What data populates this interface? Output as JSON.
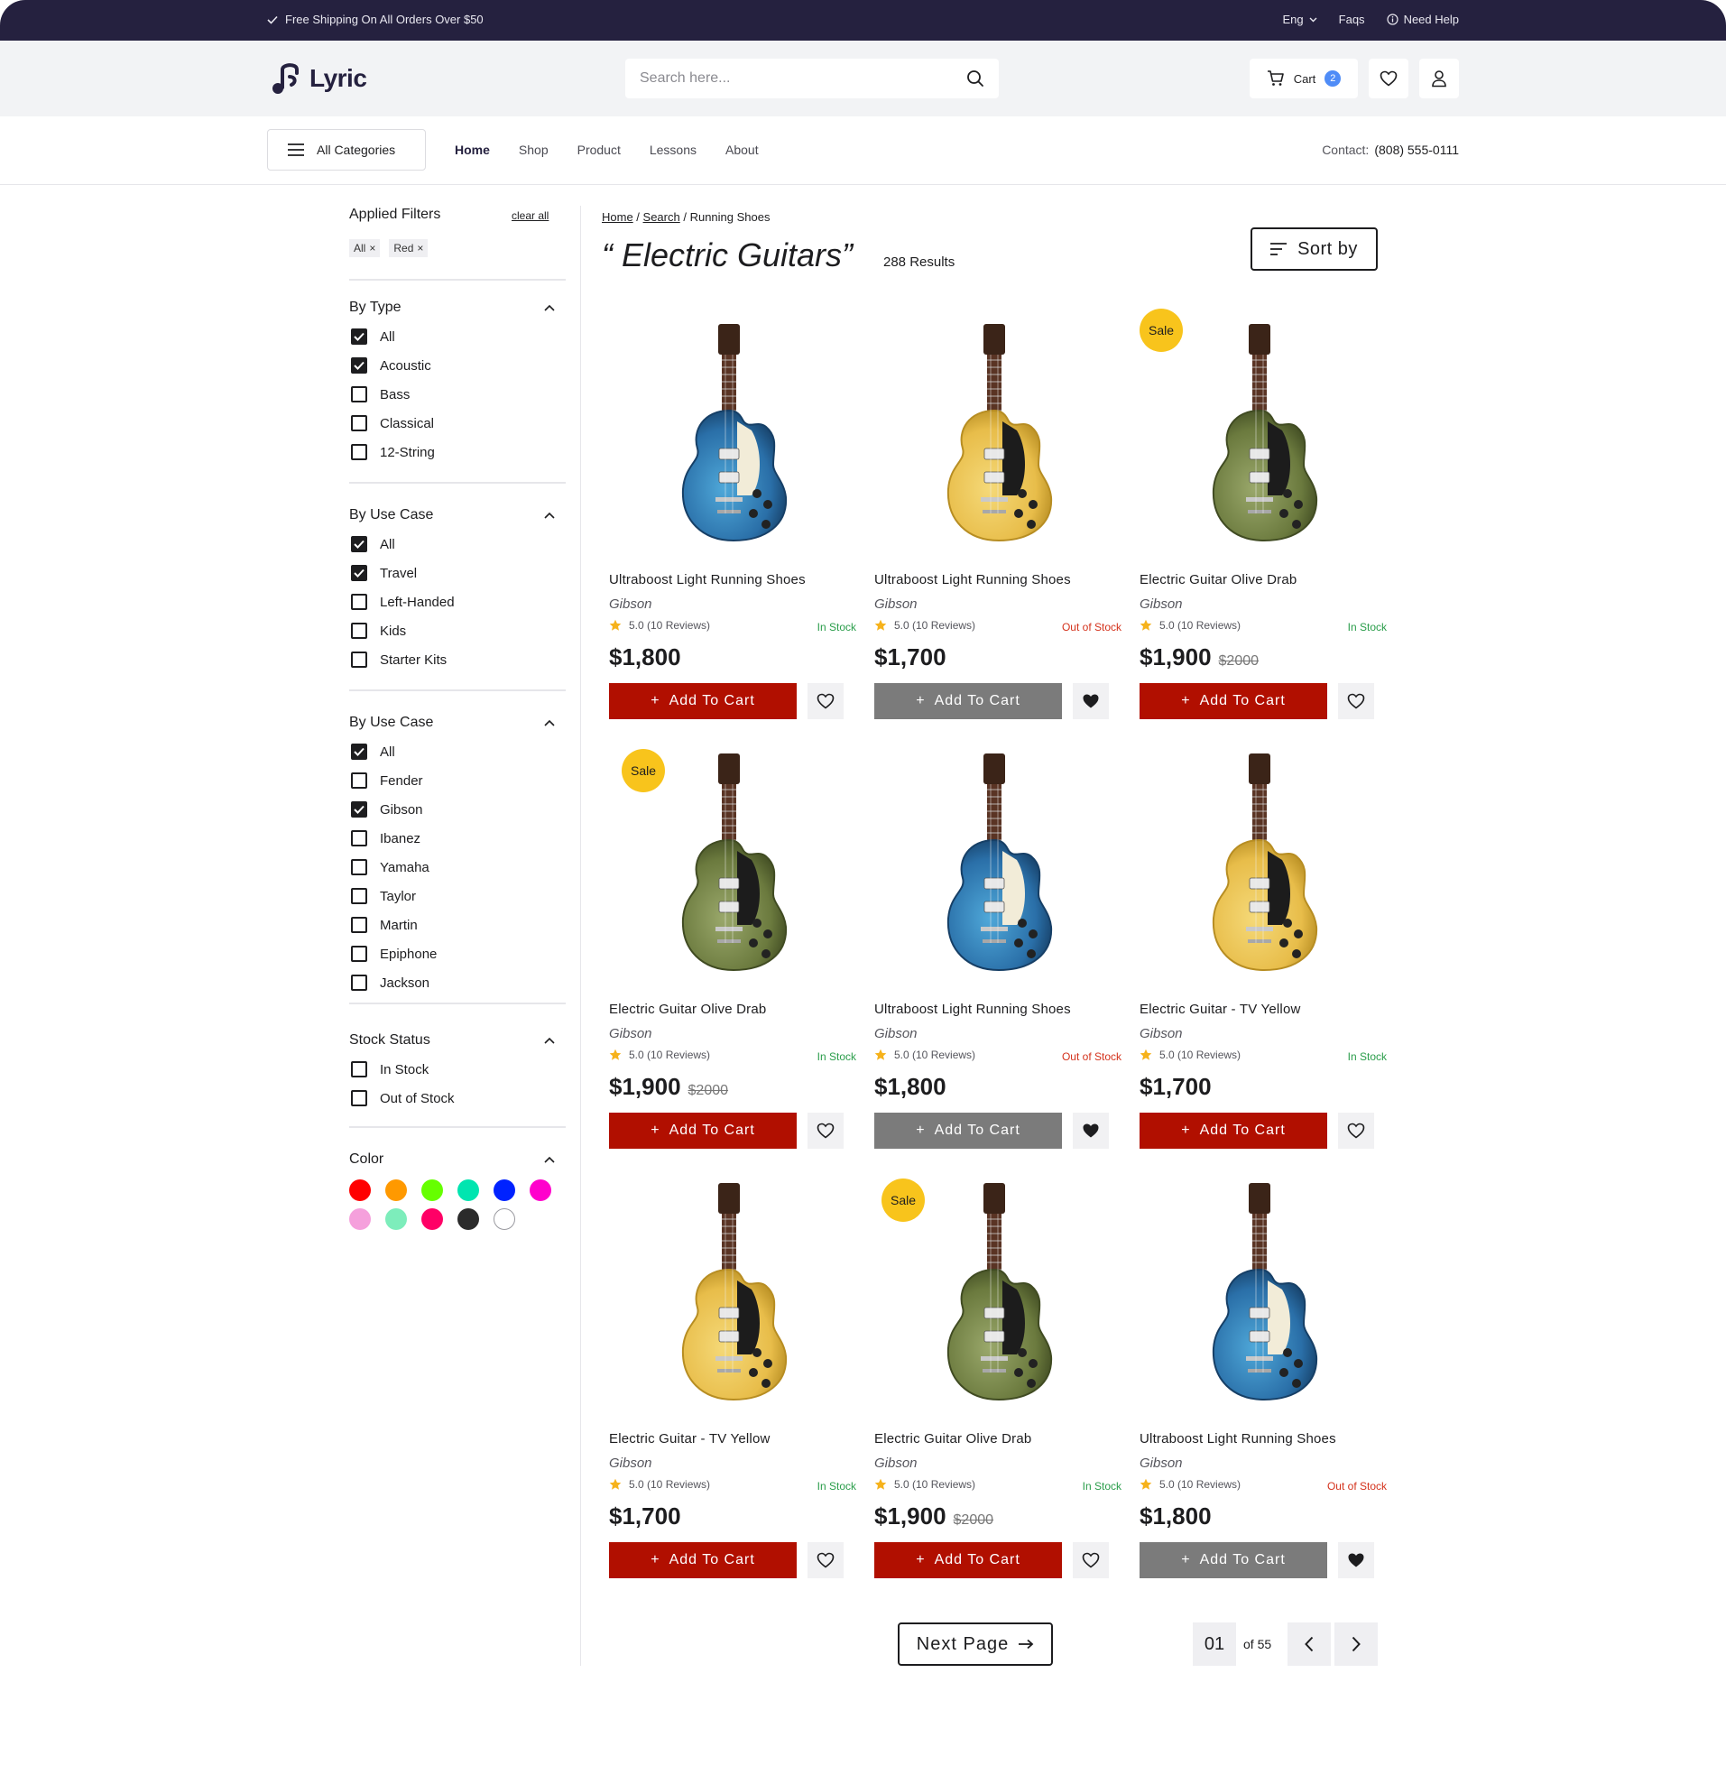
{
  "topbar": {
    "shipping": "Free Shipping On All Orders Over $50",
    "language": "Eng",
    "faqs": "Faqs",
    "help": "Need Help"
  },
  "header": {
    "logo": "Lyric",
    "search_placeholder": "Search here...",
    "cart_label": "Cart",
    "cart_count": "2"
  },
  "nav": {
    "all_categories": "All Categories",
    "items": [
      "Home",
      "Shop",
      "Product",
      "Lessons",
      "About"
    ],
    "contact_label": "Contact:",
    "contact_phone": "(808) 555-0111"
  },
  "filters": {
    "applied_title": "Applied Filters",
    "clear_all": "clear all",
    "chips": [
      "All",
      "Red"
    ],
    "groups": [
      {
        "title": "By Type",
        "options": [
          {
            "label": "All",
            "checked": true
          },
          {
            "label": "Acoustic",
            "checked": true
          },
          {
            "label": "Bass",
            "checked": false
          },
          {
            "label": "Classical",
            "checked": false
          },
          {
            "label": "12-String",
            "checked": false
          }
        ]
      },
      {
        "title": "By Use Case",
        "options": [
          {
            "label": "All",
            "checked": true
          },
          {
            "label": "Travel",
            "checked": true
          },
          {
            "label": "Left-Handed",
            "checked": false
          },
          {
            "label": "Kids",
            "checked": false
          },
          {
            "label": "Starter Kits",
            "checked": false
          }
        ]
      },
      {
        "title": "By Use Case",
        "options": [
          {
            "label": "All",
            "checked": true
          },
          {
            "label": "Fender",
            "checked": false
          },
          {
            "label": "Gibson",
            "checked": true
          },
          {
            "label": "Ibanez",
            "checked": false
          },
          {
            "label": "Yamaha",
            "checked": false
          },
          {
            "label": "Taylor",
            "checked": false
          },
          {
            "label": "Martin",
            "checked": false
          },
          {
            "label": "Epiphone",
            "checked": false
          },
          {
            "label": "Jackson",
            "checked": false
          }
        ]
      },
      {
        "title": "Stock Status",
        "options": [
          {
            "label": "In Stock",
            "checked": false
          },
          {
            "label": "Out of Stock",
            "checked": false
          }
        ]
      }
    ],
    "color_title": "Color",
    "colors": [
      "#ff0000",
      "#ff9900",
      "#66ff00",
      "#00e5b0",
      "#0022ff",
      "#ff00cc",
      "#f5a0dc",
      "#7dedbb",
      "#ff0066",
      "#2b2b2b",
      "#ffffff"
    ]
  },
  "main": {
    "breadcrumb": [
      "Home",
      "Search",
      "Running Shoes"
    ],
    "title": "“ Electric Guitars”",
    "results": "288 Results",
    "sort_label": "Sort by",
    "add_label": "Add To Cart",
    "sale_label": "Sale",
    "products": [
      {
        "name": "Ultraboost Light Running Shoes",
        "brand": "Gibson",
        "rating": "5.0 (10 Reviews)",
        "stock": "In Stock",
        "in_stock": true,
        "price": "$1,800",
        "old_price": "",
        "sale": false,
        "wished": false,
        "color": "blue"
      },
      {
        "name": "Ultraboost Light Running Shoes",
        "brand": "Gibson",
        "rating": "5.0 (10 Reviews)",
        "stock": "Out of Stock",
        "in_stock": false,
        "price": "$1,700",
        "old_price": "",
        "sale": false,
        "wished": true,
        "color": "yellow"
      },
      {
        "name": "Electric Guitar Olive Drab",
        "brand": "Gibson",
        "rating": "5.0 (10 Reviews)",
        "stock": "In Stock",
        "in_stock": true,
        "price": "$1,900",
        "old_price": "$2000",
        "sale": true,
        "wished": false,
        "color": "olive"
      },
      {
        "name": "Electric Guitar Olive Drab",
        "brand": "Gibson",
        "rating": "5.0 (10 Reviews)",
        "stock": "In Stock",
        "in_stock": true,
        "price": "$1,900",
        "old_price": "$2000",
        "sale": true,
        "wished": false,
        "color": "olive"
      },
      {
        "name": "Ultraboost Light Running Shoes",
        "brand": "Gibson",
        "rating": "5.0 (10 Reviews)",
        "stock": "Out of Stock",
        "in_stock": false,
        "price": "$1,800",
        "old_price": "",
        "sale": false,
        "wished": true,
        "color": "blue"
      },
      {
        "name": "Electric Guitar - TV Yellow",
        "brand": "Gibson",
        "rating": "5.0 (10 Reviews)",
        "stock": "In Stock",
        "in_stock": true,
        "price": "$1,700",
        "old_price": "",
        "sale": false,
        "wished": false,
        "color": "yellow"
      },
      {
        "name": "Electric Guitar - TV Yellow",
        "brand": "Gibson",
        "rating": "5.0 (10 Reviews)",
        "stock": "In Stock",
        "in_stock": true,
        "price": "$1,700",
        "old_price": "",
        "sale": false,
        "wished": false,
        "color": "yellow"
      },
      {
        "name": "Electric Guitar Olive Drab",
        "brand": "Gibson",
        "rating": "5.0 (10 Reviews)",
        "stock": "In Stock",
        "in_stock": true,
        "price": "$1,900",
        "old_price": "$2000",
        "sale": true,
        "wished": false,
        "color": "olive"
      },
      {
        "name": "Ultraboost Light Running Shoes",
        "brand": "Gibson",
        "rating": "5.0 (10 Reviews)",
        "stock": "Out of Stock",
        "in_stock": false,
        "price": "$1,800",
        "old_price": "",
        "sale": false,
        "wished": true,
        "color": "blue"
      }
    ]
  },
  "pagination": {
    "next_label": "Next Page",
    "current": "01",
    "of_label": "of 55"
  }
}
